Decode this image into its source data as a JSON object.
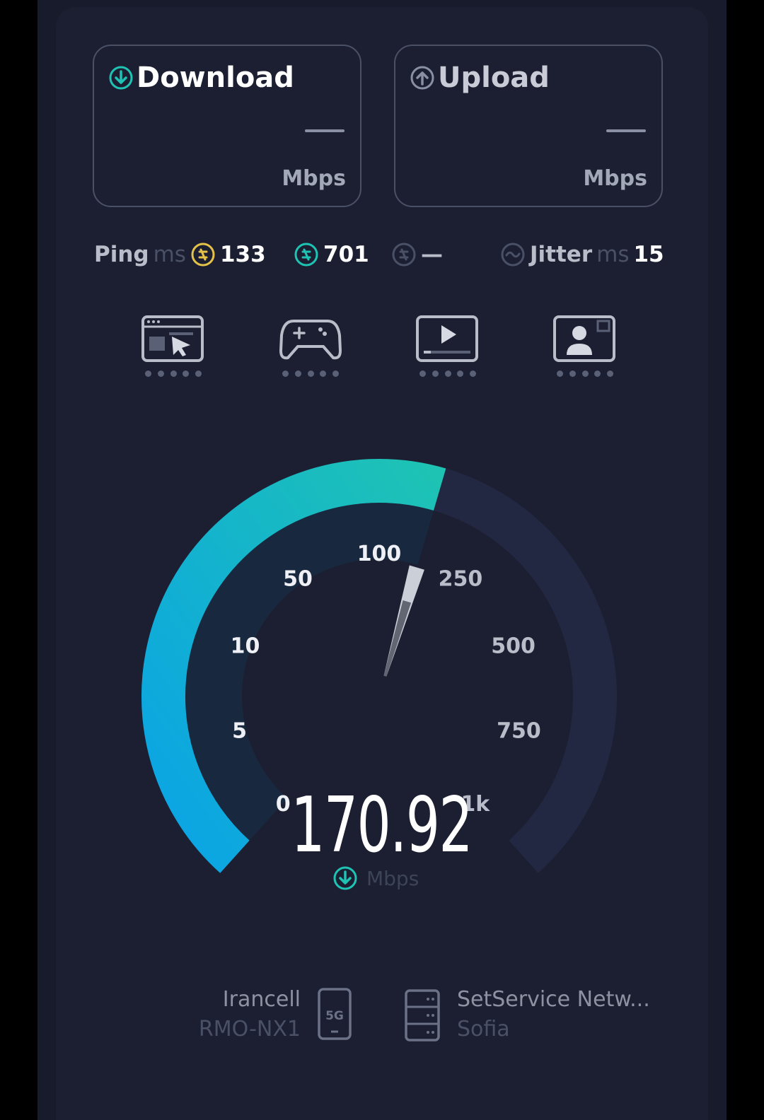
{
  "download": {
    "label": "Download",
    "value": "—",
    "unit": "Mbps"
  },
  "upload": {
    "label": "Upload",
    "value": "—",
    "unit": "Mbps"
  },
  "stats": {
    "ping_label": "Ping",
    "ping_unit": "ms",
    "idle_latency": "133",
    "download_latency": "701",
    "upload_latency": "—",
    "jitter_label": "Jitter",
    "jitter_unit": "ms",
    "jitter_value": "15"
  },
  "services": [
    {
      "name": "web-browsing",
      "rating_dots": 5
    },
    {
      "name": "gaming",
      "rating_dots": 5
    },
    {
      "name": "video-streaming",
      "rating_dots": 5
    },
    {
      "name": "video-calls",
      "rating_dots": 5
    }
  ],
  "gauge": {
    "ticks": [
      "0",
      "5",
      "10",
      "50",
      "100",
      "250",
      "500",
      "750",
      "1k"
    ],
    "current_value": 170.92,
    "reading": "170.92",
    "unit": "Mbps"
  },
  "network": {
    "provider": "Irancell",
    "device": "RMO-NX1",
    "badge": "5G"
  },
  "server": {
    "name": "SetService Netw...",
    "location": "Sofia"
  },
  "colors": {
    "accent_teal": "#1ec3b4",
    "accent_blue": "#0aa3e6",
    "ping_idle": "#e4c24a",
    "background": "#1c1f31"
  }
}
